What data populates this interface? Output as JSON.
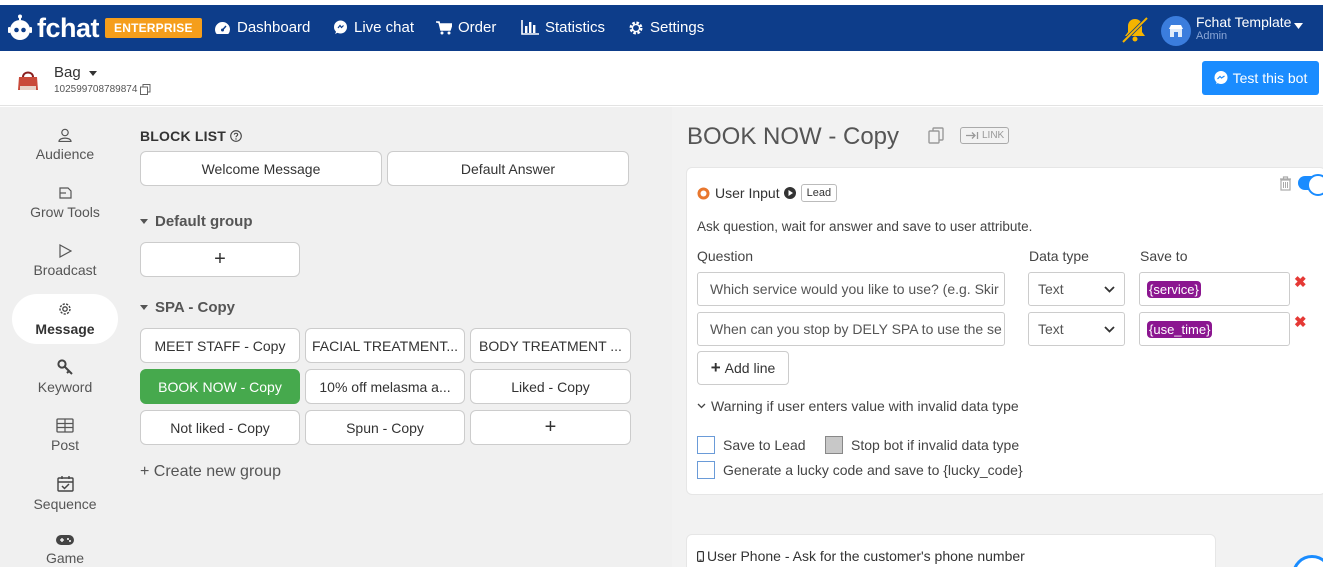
{
  "brand": {
    "logo_text": "fchat",
    "badge": "ENTERPRISE",
    "accent": "#0d3d8a",
    "badge_color": "#f59e1b"
  },
  "nav": [
    {
      "label": "Dashboard",
      "icon": "dashboard-icon"
    },
    {
      "label": "Live chat",
      "icon": "chat-bubble-icon"
    },
    {
      "label": "Order",
      "icon": "cart-icon"
    },
    {
      "label": "Statistics",
      "icon": "bar-chart-icon"
    },
    {
      "label": "Settings",
      "icon": "gear-icon"
    }
  ],
  "account": {
    "name": "Fchat Template",
    "role": "Admin"
  },
  "page": {
    "name": "Bag",
    "id": "102599708789874"
  },
  "test_button": "Test this bot",
  "sidebar": [
    {
      "label": "Audience",
      "icon": "audience-icon"
    },
    {
      "label": "Grow Tools",
      "icon": "grow-tools-icon"
    },
    {
      "label": "Broadcast",
      "icon": "broadcast-icon"
    },
    {
      "label": "Message",
      "icon": "message-icon",
      "active": true
    },
    {
      "label": "Keyword",
      "icon": "keyword-icon"
    },
    {
      "label": "Post",
      "icon": "post-icon"
    },
    {
      "label": "Sequence",
      "icon": "sequence-icon"
    },
    {
      "label": "Game",
      "icon": "game-icon"
    }
  ],
  "block_list": {
    "title": "BLOCK LIST",
    "fixed": [
      "Welcome Message",
      "Default Answer"
    ],
    "add_symbol": "+",
    "groups": [
      {
        "name": "Default group",
        "blocks": []
      },
      {
        "name": "SPA - Copy",
        "blocks": [
          "MEET STAFF - Copy",
          "FACIAL TREATMENT...",
          "BODY TREATMENT ...",
          "BOOK NOW - Copy",
          "10% off melasma a...",
          "Liked - Copy",
          "Not liked - Copy",
          "Spun - Copy"
        ],
        "selected": "BOOK NOW - Copy"
      }
    ],
    "create_group": "+ Create new group"
  },
  "detail": {
    "title": "BOOK NOW - Copy",
    "link_label": "LINK",
    "user_input": {
      "heading": "User Input",
      "tag": "Lead",
      "description": "Ask question, wait for answer and save to user attribute.",
      "columns": {
        "question": "Question",
        "data_type": "Data type",
        "save_to": "Save to"
      },
      "rows": [
        {
          "question": "Which service would you like to use? (e.g. Skir",
          "data_type": "Text",
          "save_to": "{service}"
        },
        {
          "question": "When can you stop by DELY SPA to use the se",
          "data_type": "Text",
          "save_to": "{use_time}"
        }
      ],
      "add_line": "Add line",
      "warning": "Warning if user enters value with invalid data type",
      "options": {
        "save_to_lead": "Save to Lead",
        "stop_bot": "Stop bot if invalid data type",
        "lucky_code": "Generate a lucky code and save to {lucky_code}"
      }
    },
    "user_phone": "User Phone - Ask for the customer's phone number"
  }
}
